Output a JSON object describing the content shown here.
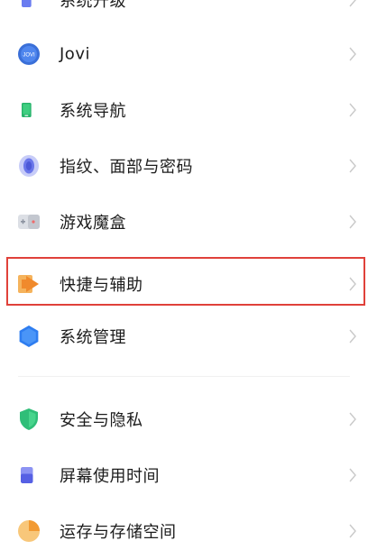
{
  "items": [
    {
      "label": "系统升级",
      "icon": "system-update-icon"
    },
    {
      "label": "Jovi",
      "icon": "jovi-icon",
      "icon_text": "JOVI"
    },
    {
      "label": "系统导航",
      "icon": "system-navigation-icon"
    },
    {
      "label": "指纹、面部与密码",
      "icon": "fingerprint-icon"
    },
    {
      "label": "游戏魔盒",
      "icon": "game-box-icon"
    },
    {
      "label": "快捷与辅助",
      "icon": "shortcut-assist-icon"
    },
    {
      "label": "系统管理",
      "icon": "system-management-icon"
    },
    {
      "label": "安全与隐私",
      "icon": "security-privacy-icon"
    },
    {
      "label": "屏幕使用时间",
      "icon": "screen-time-icon"
    },
    {
      "label": "运存与存储空间",
      "icon": "storage-icon"
    }
  ],
  "colors": {
    "highlight_border": "#e0413a",
    "text": "#1c1c1c",
    "chevron": "#c9c9c9"
  }
}
